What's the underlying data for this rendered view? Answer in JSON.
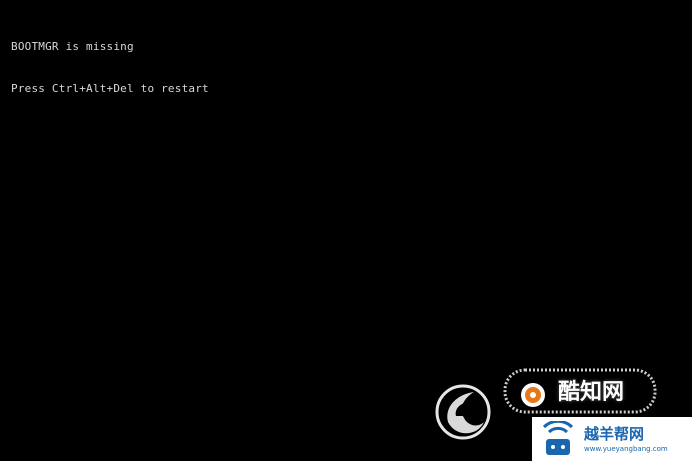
{
  "console": {
    "lines": [
      "BOOTMGR is missing",
      "Press Ctrl+Alt+Del to restart"
    ],
    "text_color": "#d8d8d8",
    "background_color": "#000000"
  },
  "watermarks": {
    "badge": {
      "text": "酷知网"
    },
    "site": {
      "name": "越羊帮网",
      "url": "www.yueyangbang.com",
      "color": "#1a66b0"
    },
    "icons": [
      "swirl-logo-icon",
      "badge-logo-icon",
      "wifi-house-logo-icon"
    ]
  }
}
